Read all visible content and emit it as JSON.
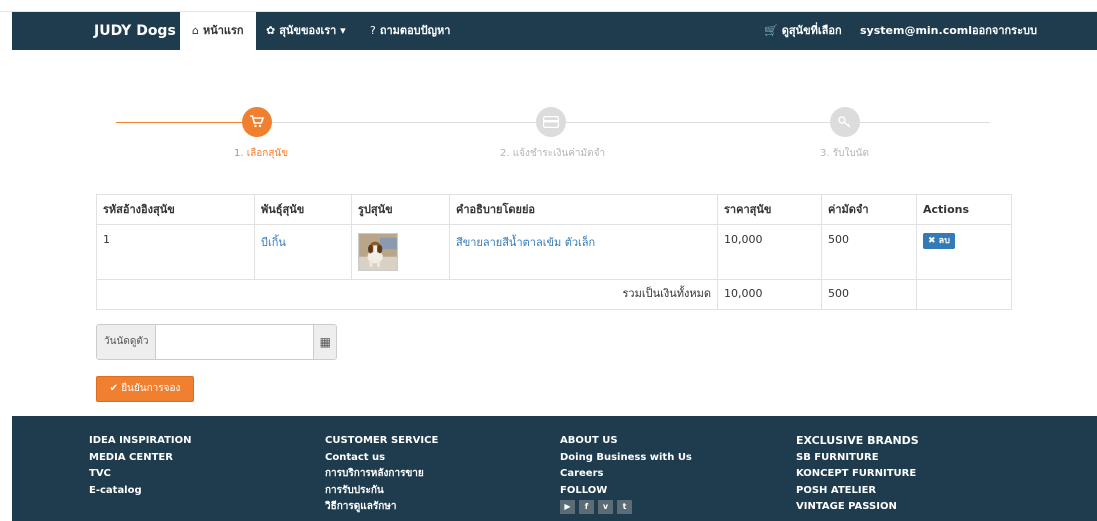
{
  "nav": {
    "brand": "JUDY Dogs",
    "home": "หน้าแรก",
    "our_dogs": "สุนัขของเรา ▾",
    "faq": "ถามตอบปัญหา",
    "cart": "ดูสุนัขที่เลือก",
    "user": "system@min.coml",
    "logout": "ออกจากระบบ"
  },
  "steps": [
    {
      "label": "1. เลือกสุนัข",
      "icon": "cart-icon",
      "state": "active"
    },
    {
      "label": "2. แจ้งชำระเงินค่ามัดจำ",
      "icon": "payment-card-icon",
      "state": "inactive"
    },
    {
      "label": "3. รับใบนัด",
      "icon": "key-icon",
      "state": "inactive"
    }
  ],
  "table": {
    "headers": [
      "รหัสอ้างอิงสุนัข",
      "พันธุ์สุนัข",
      "รูปสุนัข",
      "คำอธิบายโดยย่อ",
      "ราคาสุนัข",
      "ค่ามัดจำ",
      "Actions"
    ],
    "rows": [
      {
        "id": "1",
        "breed": "บีเกิ้น",
        "description": "สีขายลายสีน้ำตาลเข้ม ตัวเล็ก",
        "price": "10,000",
        "deposit": "500",
        "action": "✖ ลบ"
      }
    ],
    "total_label": "รวมเป็นเงินทั้งหมด",
    "total_price": "10,000",
    "total_deposit": "500"
  },
  "date_field": {
    "label": "วันนัดดูตัวสุนัข",
    "value": "",
    "placeholder": ""
  },
  "confirm_label": "ยืนยันการจอง",
  "footer": {
    "col1": [
      "IDEA INSPIRATION",
      "MEDIA CENTER",
      "TVC",
      "E-catalog"
    ],
    "col2": [
      "CUSTOMER SERVICE",
      "Contact us",
      "การบริการหลังการขาย",
      "การรับประกัน",
      "วิธีการดูแลรักษา"
    ],
    "col3": [
      "ABOUT US",
      "Doing Business with Us",
      "Careers",
      "FOLLOW"
    ],
    "col4": [
      "EXCLUSIVE BRANDS",
      "SB FURNITURE",
      "KONCEPT FURNITURE",
      "POSH ATELIER",
      "VINTAGE PASSION"
    ],
    "social": [
      "youtube-icon",
      "facebook-icon",
      "vimeo-icon",
      "twitter-icon"
    ]
  },
  "colors": {
    "navbar": "#1e3c4e",
    "accent": "#f07f2f",
    "link": "#337ab7"
  }
}
